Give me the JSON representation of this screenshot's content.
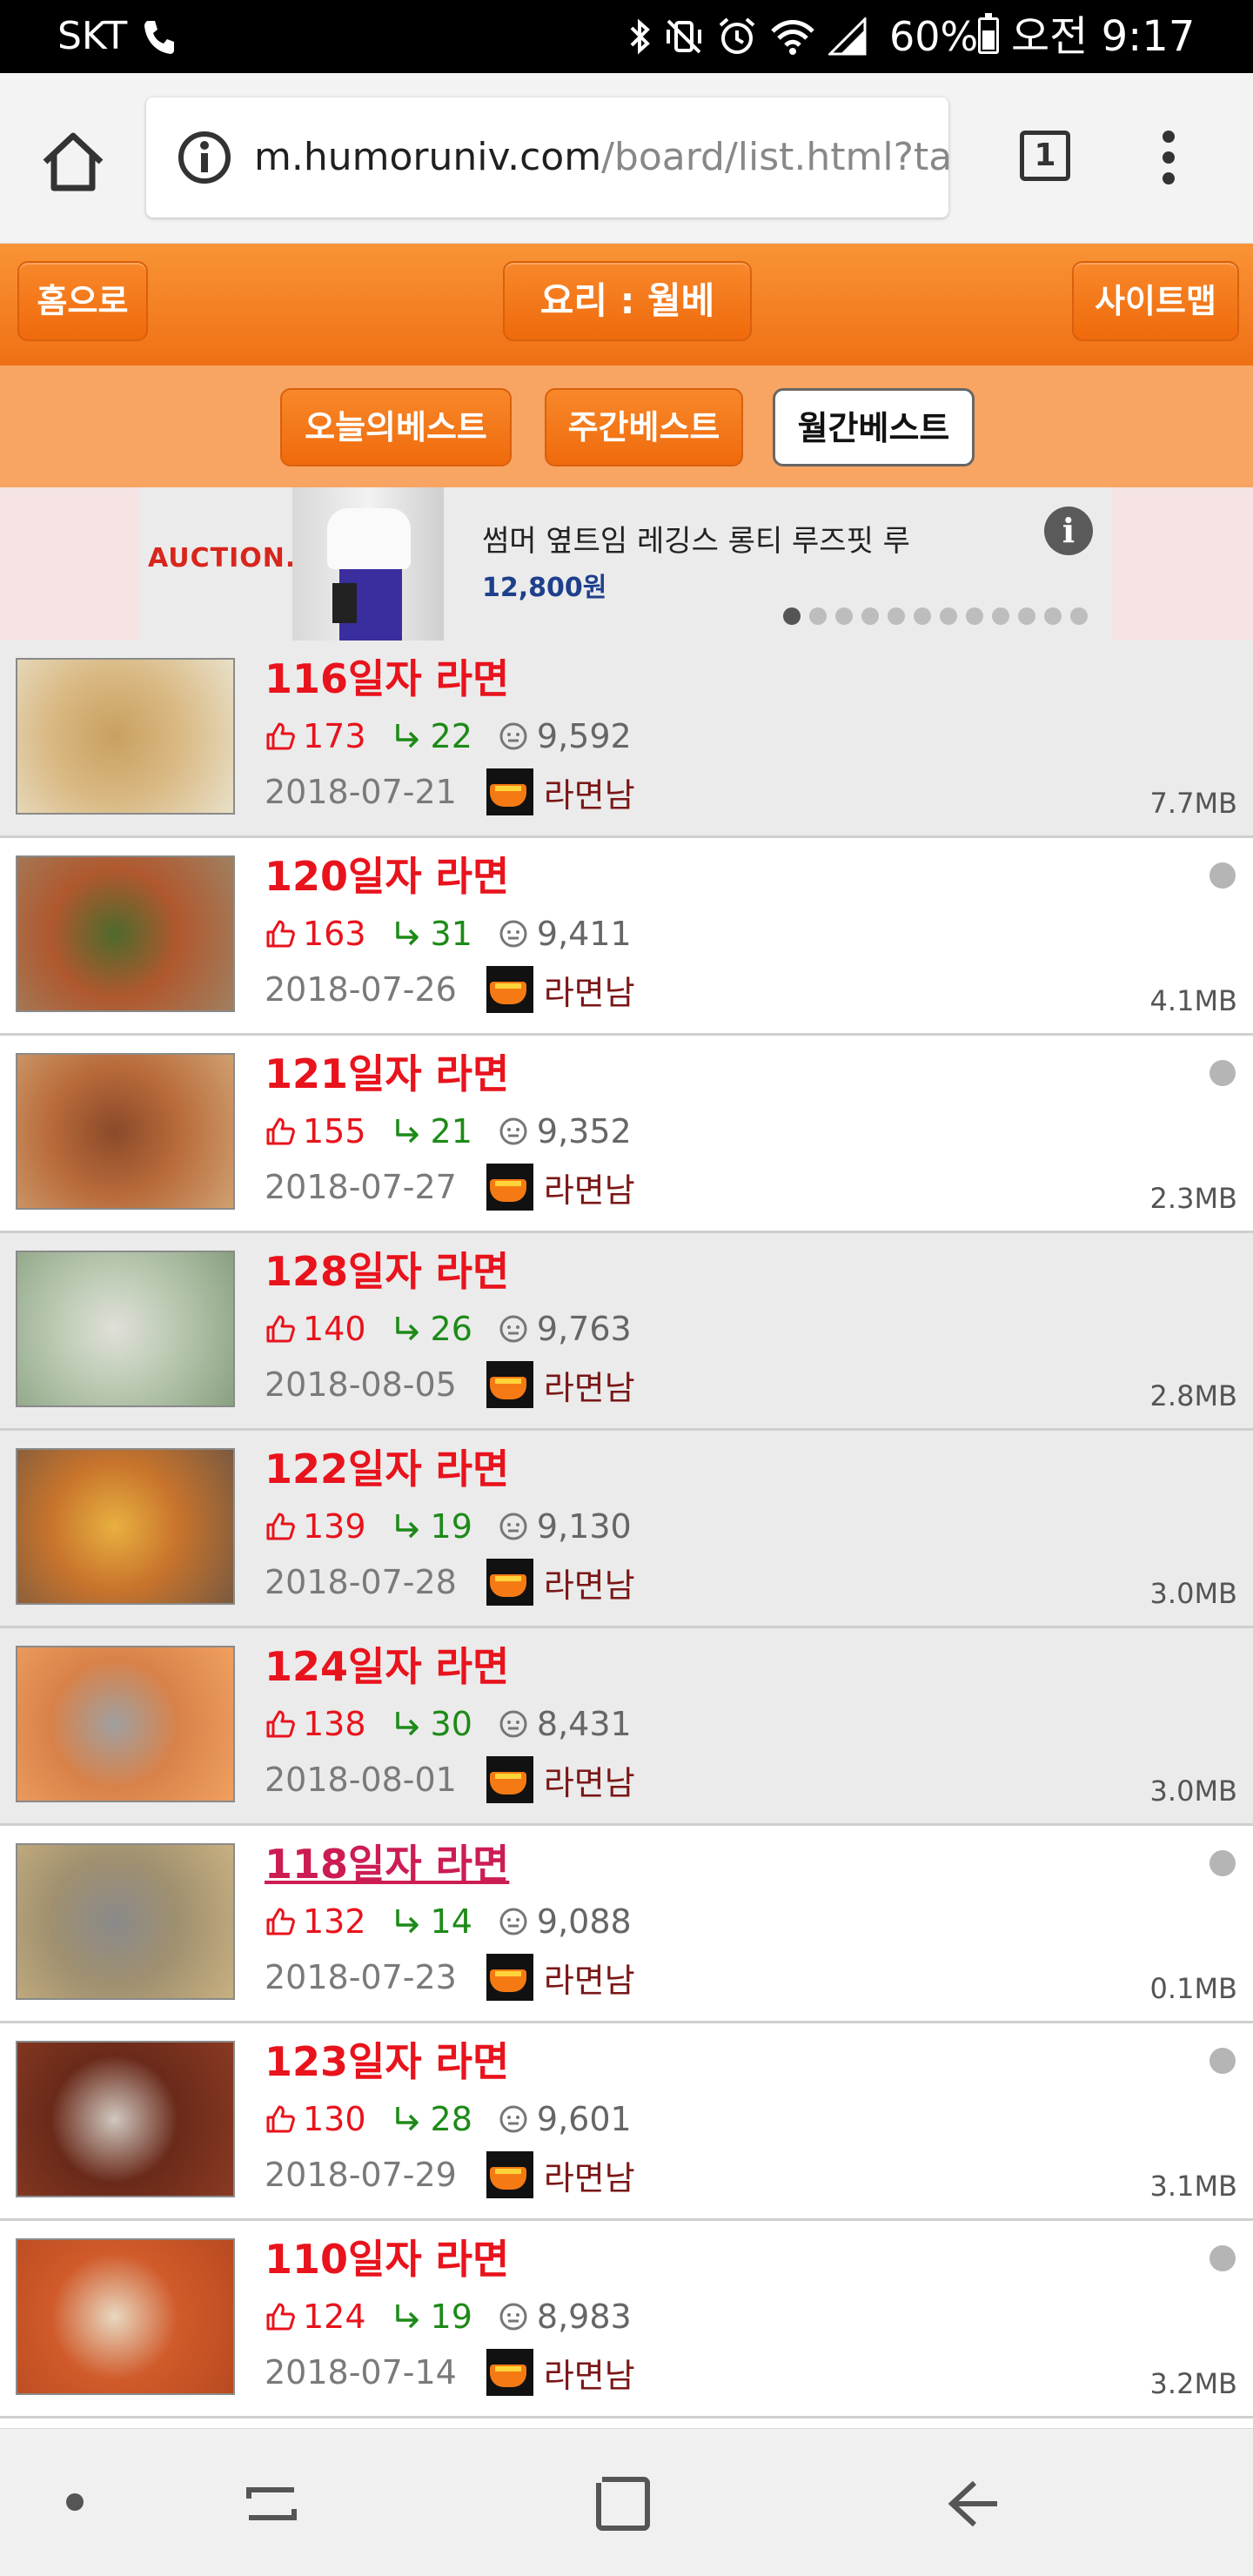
{
  "status_bar": {
    "carrier": "SKT",
    "battery": "60%",
    "time": "오전 9:17"
  },
  "browser": {
    "url_host": "m.humoruniv.com",
    "url_path": "/board/list.html?tab",
    "tab_count": "1"
  },
  "nav": {
    "home_label": "홈으로",
    "board_title": "요리 : 월베",
    "sitemap_label": "사이트맵",
    "tabs": [
      {
        "label": "오늘의베스트",
        "selected": false
      },
      {
        "label": "주간베스트",
        "selected": false
      },
      {
        "label": "월간베스트",
        "selected": true
      }
    ]
  },
  "ad": {
    "brand": "AUCTION.",
    "title": "썸머 옆트임 레깅스 롱티 루즈핏 루",
    "price": "12,800원",
    "info_symbol": "i",
    "page_count": 12,
    "active_page": 1
  },
  "posts": [
    {
      "title": "116일자 라면",
      "likes": "173",
      "replies": "22",
      "views": "9,592",
      "date": "2018-07-21",
      "author": "라면남",
      "size": "7.7MB",
      "new": false,
      "visited": false,
      "row": "gray",
      "thumb_colors": [
        "#d9b882",
        "#c9a060",
        "#e8e0c8"
      ]
    },
    {
      "title": "120일자 라면",
      "likes": "163",
      "replies": "31",
      "views": "9,411",
      "date": "2018-07-26",
      "author": "라면남",
      "size": "4.1MB",
      "new": true,
      "visited": false,
      "row": "white",
      "thumb_colors": [
        "#b0582e",
        "#4e6a2c",
        "#a08060"
      ]
    },
    {
      "title": "121일자 라면",
      "likes": "155",
      "replies": "21",
      "views": "9,352",
      "date": "2018-07-27",
      "author": "라면남",
      "size": "2.3MB",
      "new": true,
      "visited": false,
      "row": "white",
      "thumb_colors": [
        "#b86a3a",
        "#8a4a2a",
        "#d0a070"
      ]
    },
    {
      "title": "128일자 라면",
      "likes": "140",
      "replies": "26",
      "views": "9,763",
      "date": "2018-08-05",
      "author": "라면남",
      "size": "2.8MB",
      "new": false,
      "visited": false,
      "row": "gray",
      "thumb_colors": [
        "#b8c8b0",
        "#e0e0d8",
        "#8aa080"
      ]
    },
    {
      "title": "122일자 라면",
      "likes": "139",
      "replies": "19",
      "views": "9,130",
      "date": "2018-07-28",
      "author": "라면남",
      "size": "3.0MB",
      "new": false,
      "visited": false,
      "row": "gray",
      "thumb_colors": [
        "#c8742c",
        "#e8b040",
        "#7a5a40"
      ]
    },
    {
      "title": "124일자 라면",
      "likes": "138",
      "replies": "30",
      "views": "8,431",
      "date": "2018-08-01",
      "author": "라면남",
      "size": "3.0MB",
      "new": false,
      "visited": false,
      "row": "gray",
      "thumb_colors": [
        "#d8824a",
        "#a0a0a0",
        "#f0a060"
      ]
    },
    {
      "title": "118일자 라면",
      "likes": "132",
      "replies": "14",
      "views": "9,088",
      "date": "2018-07-23",
      "author": "라면남",
      "size": "0.1MB",
      "new": true,
      "visited": true,
      "row": "white",
      "thumb_colors": [
        "#a09070",
        "#8a8a8a",
        "#c8b080"
      ]
    },
    {
      "title": "123일자 라면",
      "likes": "130",
      "replies": "28",
      "views": "9,601",
      "date": "2018-07-29",
      "author": "라면남",
      "size": "3.1MB",
      "new": true,
      "visited": false,
      "row": "white",
      "thumb_colors": [
        "#6a2a1a",
        "#d0c8c0",
        "#8a3a22"
      ]
    },
    {
      "title": "110일자 라면",
      "likes": "124",
      "replies": "19",
      "views": "8,983",
      "date": "2018-07-14",
      "author": "라면남",
      "size": "3.2MB",
      "new": true,
      "visited": false,
      "row": "white",
      "thumb_colors": [
        "#d05a2a",
        "#e8d8c0",
        "#b84a20"
      ]
    }
  ],
  "icons": {
    "like": "thumbs-up-icon",
    "reply": "reply-arrow-icon",
    "views": "face-icon",
    "new": "new-indicator-dot"
  },
  "colors": {
    "accent_orange": "#f07014",
    "title_red": "#e8131c",
    "reply_green": "#1d8a18",
    "visited_pink": "#cc1d52"
  }
}
